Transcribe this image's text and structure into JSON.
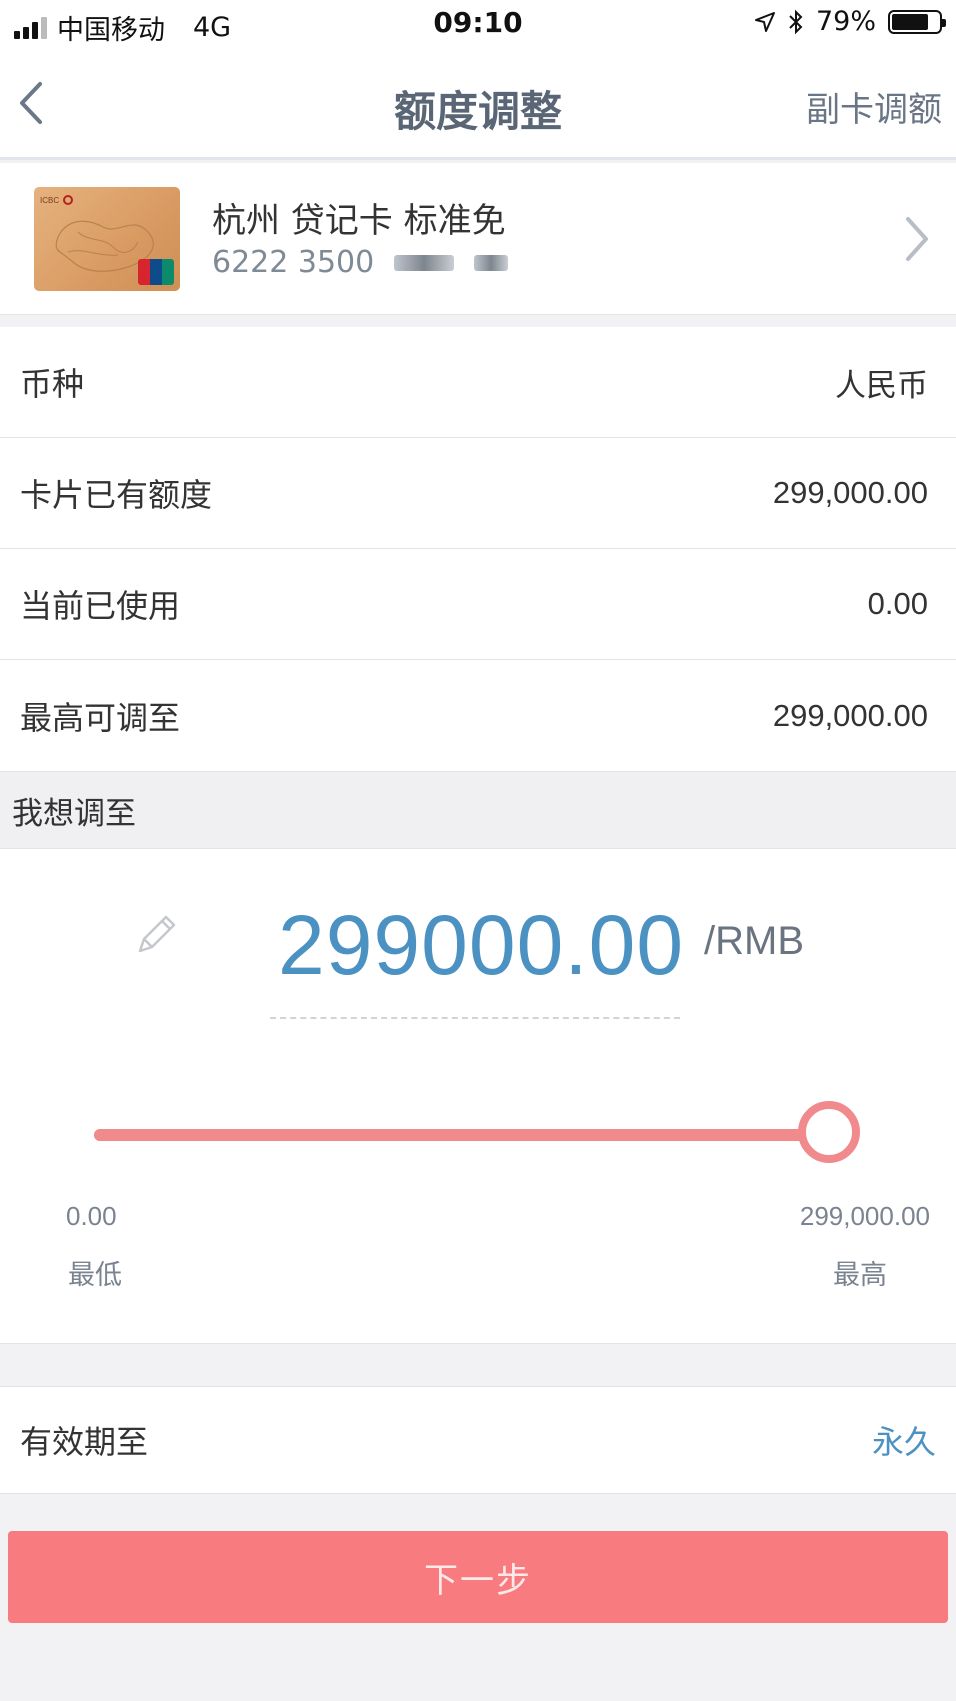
{
  "status_bar": {
    "carrier": "中国移动",
    "network": "4G",
    "time": "09:10",
    "battery": "79%",
    "battery_level": 0.79
  },
  "nav": {
    "title": "额度调整",
    "action_label": "副卡调额"
  },
  "card": {
    "name": "杭州 贷记卡 标准免",
    "number_prefix": "6222 3500"
  },
  "info_rows": [
    {
      "label": "币种",
      "value": "人民币"
    },
    {
      "label": "卡片已有额度",
      "value": "299,000.00"
    },
    {
      "label": "当前已使用",
      "value": "0.00"
    },
    {
      "label": "最高可调至",
      "value": "299,000.00"
    }
  ],
  "adjust": {
    "header": "我想调至",
    "amount": "299000.00",
    "unit": "/RMB",
    "slider": {
      "min_value": "0.00",
      "max_value": "299,000.00",
      "min_label": "最低",
      "max_label": "最高",
      "level": 1.0
    }
  },
  "validity": {
    "label": "有效期至",
    "value": "永久"
  },
  "next_button": "下一步",
  "colors": {
    "accent_blue": "#4b92c3",
    "slider_red": "#f08a8c",
    "button_red": "#f87b7f"
  }
}
